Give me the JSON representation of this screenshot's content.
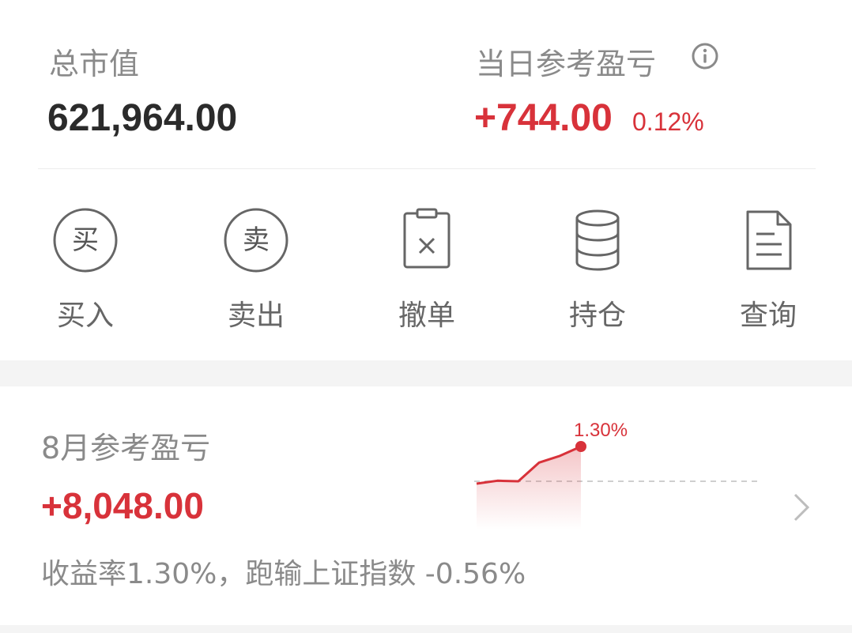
{
  "summary": {
    "total_market_value_label": "总市值",
    "total_market_value": "621,964.00",
    "daily_pnl_label": "当日参考盈亏",
    "daily_pnl_value": "+744.00",
    "daily_pnl_percent": "0.12%"
  },
  "actions": [
    {
      "label": "买入",
      "icon": "buy-icon",
      "glyph": "买"
    },
    {
      "label": "卖出",
      "icon": "sell-icon",
      "glyph": "卖"
    },
    {
      "label": "撤单",
      "icon": "cancel-order-icon"
    },
    {
      "label": "持仓",
      "icon": "holdings-icon"
    },
    {
      "label": "查询",
      "icon": "document-icon"
    }
  ],
  "monthly": {
    "label": "8月参考盈亏",
    "value": "+8,048.00",
    "summary": "收益率1.30%，跑输上证指数 -0.56%",
    "chart_label": "1.30%"
  },
  "chart_data": {
    "type": "area",
    "title": "",
    "values": [
      0.0,
      0.02,
      0.0,
      0.7,
      0.95,
      1.3
    ],
    "baseline": 0,
    "end_label": "1.30%",
    "color": "#d8323a"
  },
  "colors": {
    "accent_red": "#d8323a",
    "text_dark": "#2b2b2b",
    "text_gray": "#8a8a8a",
    "background": "#f4f4f4"
  }
}
